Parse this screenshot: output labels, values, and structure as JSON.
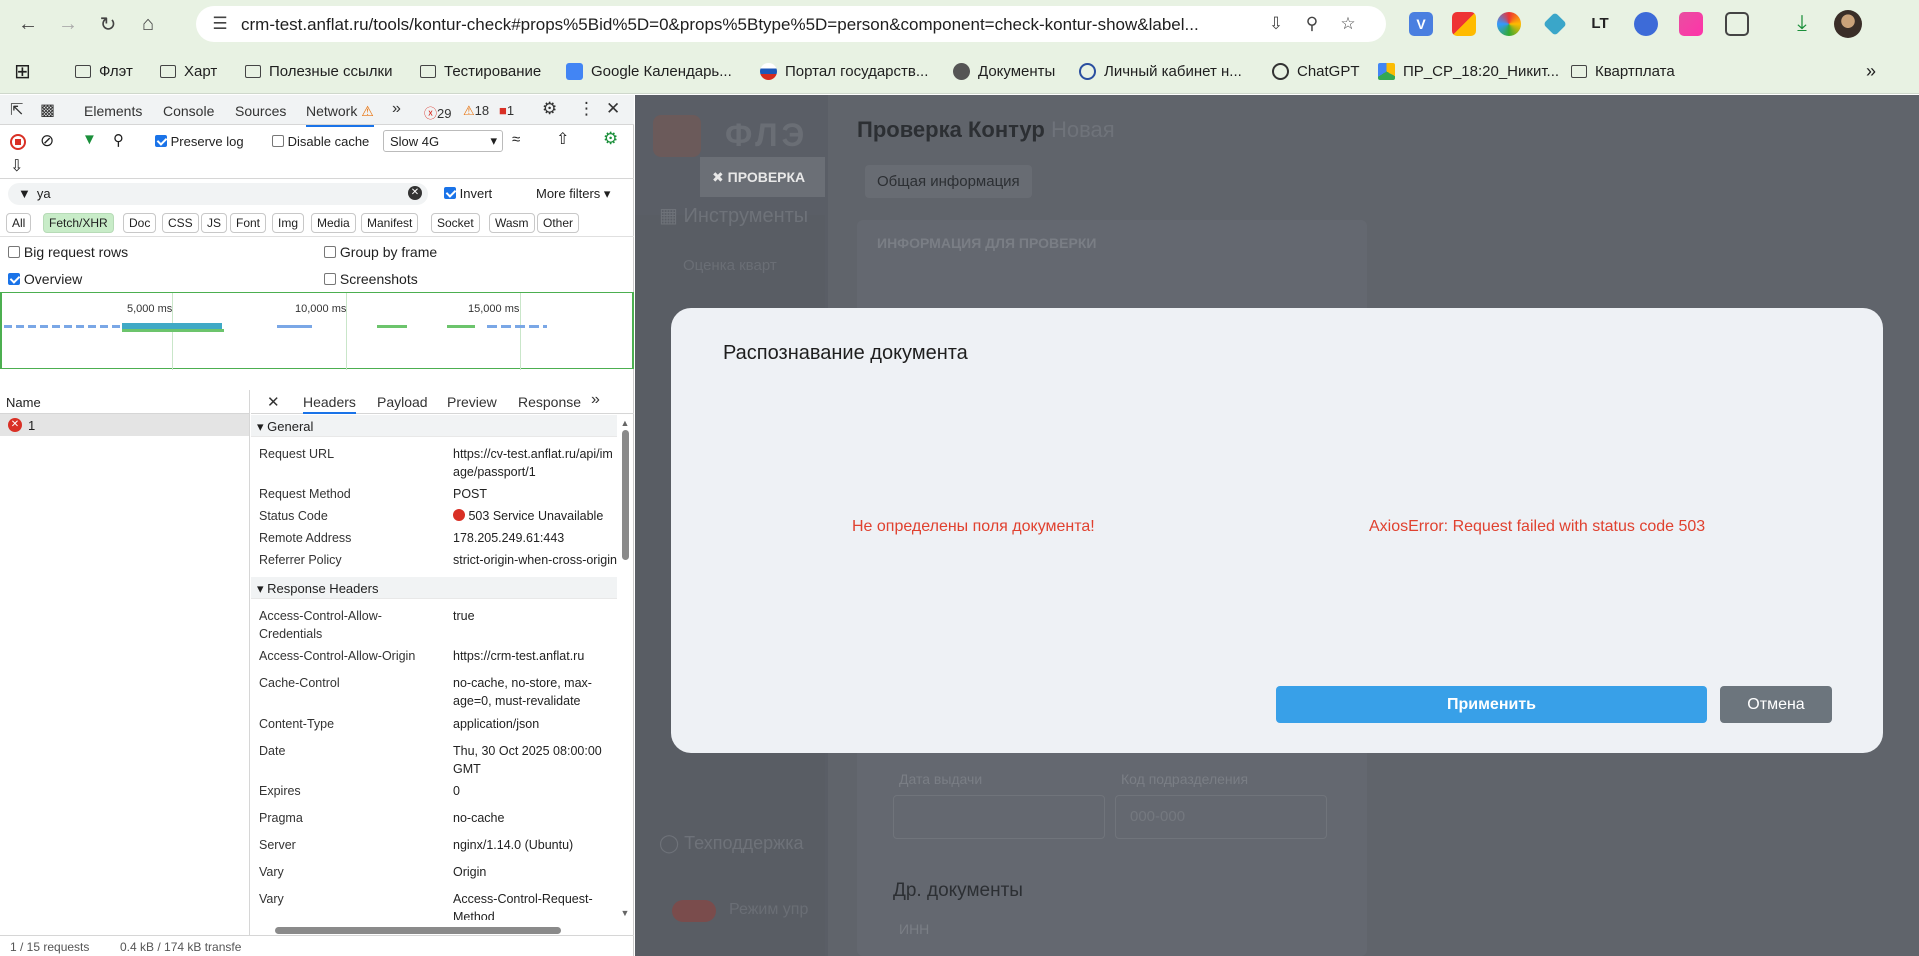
{
  "browser": {
    "url": "crm-test.anflat.ru/tools/kontur-check#props%5Bid%5D=0&props%5Btype%5D=person&component=check-kontur-show&label...",
    "bookmarks": [
      "Флэт",
      "Харт",
      "Полезные ссылки",
      "Тестирование",
      "Google Календарь...",
      "Портал государств...",
      "Документы",
      "Личный кабинет н...",
      "ChatGPT",
      "ПР_CP_18:20_Никит...",
      "Квартплата"
    ]
  },
  "devtools": {
    "tabs": [
      "Elements",
      "Console",
      "Sources",
      "Network"
    ],
    "errors": "29",
    "warnings": "18",
    "issues": "1",
    "preserve_log": "Preserve log",
    "disable_cache": "Disable cache",
    "throttle": "Slow 4G",
    "filter_value": "ya",
    "invert": "Invert",
    "more_filters": "More filters",
    "types": [
      "All",
      "Fetch/XHR",
      "Doc",
      "CSS",
      "JS",
      "Font",
      "Img",
      "Media",
      "Manifest",
      "Socket",
      "Wasm",
      "Other"
    ],
    "options": {
      "big_rows": "Big request rows",
      "group_by_frame": "Group by frame",
      "overview": "Overview",
      "screenshots": "Screenshots"
    },
    "timeline_labels": [
      "5,000 ms",
      "10,000 ms",
      "15,000 ms"
    ],
    "list_header": "Name",
    "request_name": "1",
    "detail_tabs": [
      "Headers",
      "Payload",
      "Preview",
      "Response"
    ],
    "general_title": "General",
    "general": [
      {
        "k": "Request URL",
        "v": "https://cv-test.anflat.ru/api/image/passport/1"
      },
      {
        "k": "Request Method",
        "v": "POST"
      },
      {
        "k": "Status Code",
        "v": "503 Service Unavailable"
      },
      {
        "k": "Remote Address",
        "v": "178.205.249.61:443"
      },
      {
        "k": "Referrer Policy",
        "v": "strict-origin-when-cross-origin"
      }
    ],
    "response_title": "Response Headers",
    "response": [
      {
        "k": "Access-Control-Allow-Credentials",
        "v": "true"
      },
      {
        "k": "Access-Control-Allow-Origin",
        "v": "https://crm-test.anflat.ru"
      },
      {
        "k": "Cache-Control",
        "v": "no-cache, no-store, max-age=0, must-revalidate"
      },
      {
        "k": "Content-Type",
        "v": "application/json"
      },
      {
        "k": "Date",
        "v": "Thu, 30 Oct 2025 08:00:00 GMT"
      },
      {
        "k": "Expires",
        "v": "0"
      },
      {
        "k": "Pragma",
        "v": "no-cache"
      },
      {
        "k": "Server",
        "v": "nginx/1.14.0 (Ubuntu)"
      },
      {
        "k": "Vary",
        "v": "Origin"
      },
      {
        "k": "Vary",
        "v": "Access-Control-Request-Method"
      }
    ],
    "status_requests": "1 / 15 requests",
    "status_size": "0.4 kB / 174 kB transfe"
  },
  "app": {
    "logo": "ФЛЭ",
    "page_title": "Проверка Контур",
    "page_status": "Новая",
    "close_tab": "ПРОВЕРКА",
    "tab_general": "Общая информация",
    "section_info": "ИНФОРМАЦИЯ ДЛЯ ПРОВЕРКИ",
    "menu_tools": "Инструменты",
    "menu_sub": "Оценка кварт",
    "support": "Техподдержка",
    "mode_toggle": "Режим упр",
    "issue_date": "Дата выдачи",
    "dept_code": "Код подразделения",
    "dept_placeholder": "000-000",
    "other_docs": "Др. документы",
    "inn": "ИНН"
  },
  "modal": {
    "title": "Распознавание документа",
    "error_left": "Не определены поля документа!",
    "error_right": "AxiosError: Request failed with status code 503",
    "apply": "Применить",
    "cancel": "Отмена"
  }
}
